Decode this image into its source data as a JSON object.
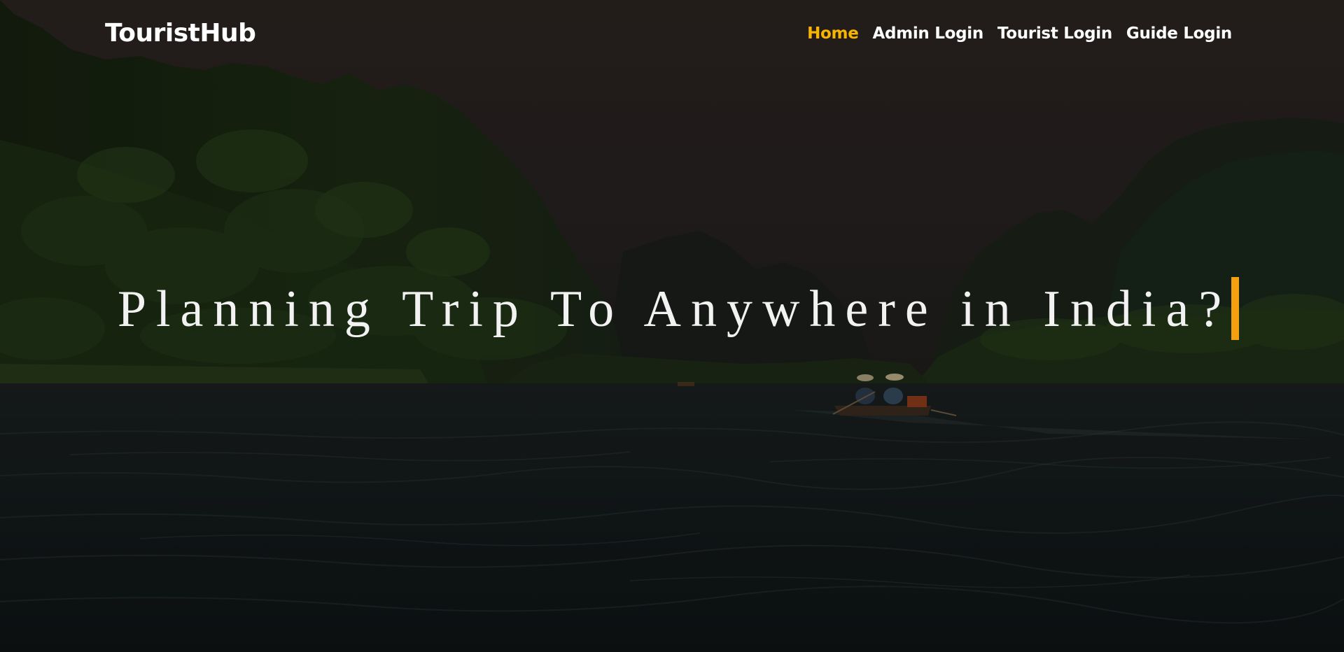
{
  "brand": {
    "name": "TouristHub"
  },
  "nav": {
    "items": [
      {
        "label": "Home",
        "active": true
      },
      {
        "label": "Admin Login",
        "active": false
      },
      {
        "label": "Tourist Login",
        "active": false
      },
      {
        "label": "Guide Login",
        "active": false
      }
    ]
  },
  "hero": {
    "headline": "Planning Trip To Anywhere in India?",
    "cursor_color": "#f5a00f"
  },
  "colors": {
    "accent": "#f7b500",
    "text": "#ffffff"
  }
}
